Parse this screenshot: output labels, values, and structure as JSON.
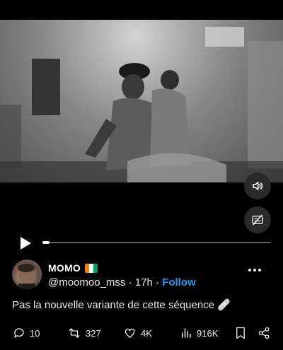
{
  "video": {
    "controls": {
      "volume_icon": "volume-icon",
      "captions_icon": "captions-off-icon",
      "play_icon": "play-icon"
    },
    "progress": 0.03
  },
  "post": {
    "author": {
      "display_name": "MOMO",
      "flag_emoji": "🇨🇮",
      "flag_colors": [
        "#f77f00",
        "#ffffff",
        "#009e60"
      ],
      "handle": "@moomoo_mss",
      "time": "17h",
      "separator": "·",
      "follow_label": "Follow"
    },
    "text": "Pas la nouvelle variante de cette séquence",
    "emoji": "🩹",
    "stats": {
      "replies": "10",
      "reposts": "327",
      "likes": "4K",
      "views": "916K"
    }
  },
  "theme": {
    "accent": "#1d9bf0",
    "text": "#e7e9ea",
    "background": "#000000"
  }
}
